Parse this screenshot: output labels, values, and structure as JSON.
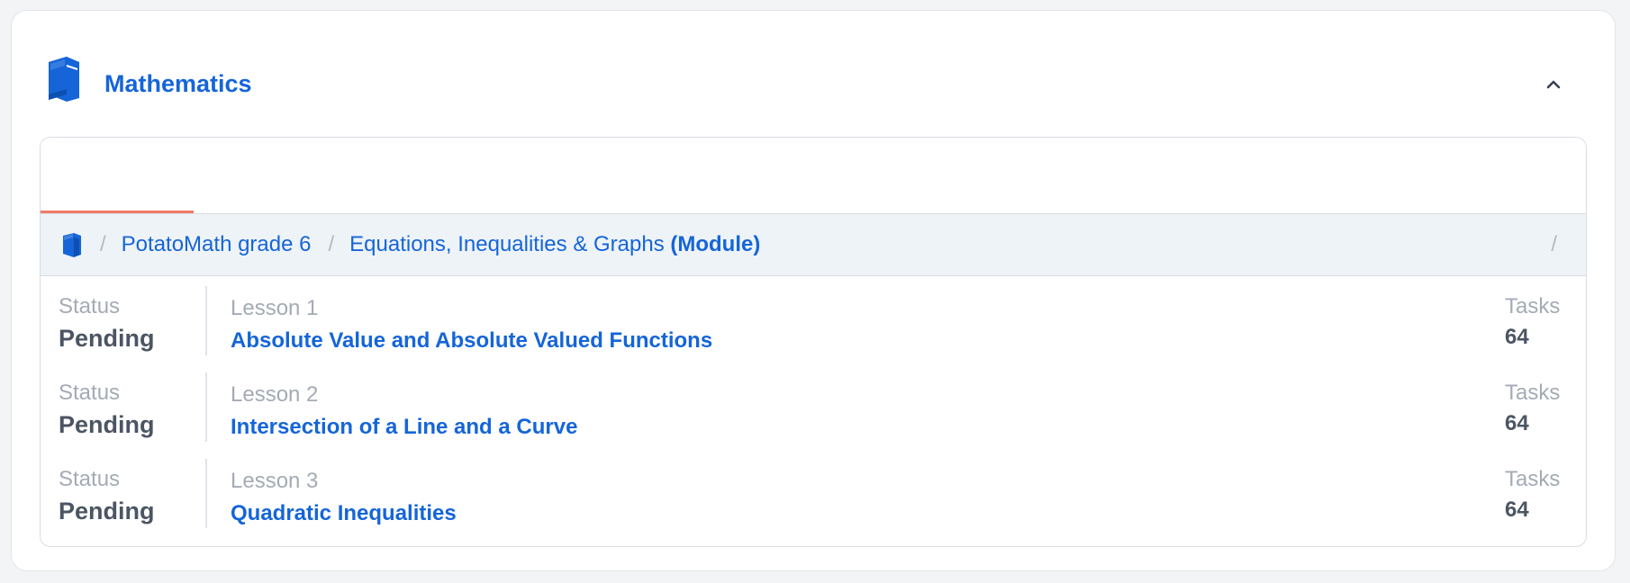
{
  "subject": {
    "icon": "book-icon",
    "title": "Mathematics",
    "collapse_icon": "chevron-up-icon",
    "accent_color": "#1565d8"
  },
  "breadcrumb": {
    "home_icon": "book-icon",
    "separator": "/",
    "course": "PotatoMath grade 6",
    "module_name": "Equations, Inequalities & Graphs",
    "module_type": "(Module)",
    "trailing_separator": "/"
  },
  "tab_indicator_color": "#f07a65",
  "lessons": [
    {
      "status_label": "Status",
      "status": "Pending",
      "lesson_label": "Lesson 1",
      "title": "Absolute Value and Absolute Valued Functions",
      "tasks_label": "Tasks",
      "tasks": "64"
    },
    {
      "status_label": "Status",
      "status": "Pending",
      "lesson_label": "Lesson 2",
      "title": "Intersection of a Line and a Curve",
      "tasks_label": "Tasks",
      "tasks": "64"
    },
    {
      "status_label": "Status",
      "status": "Pending",
      "lesson_label": "Lesson 3",
      "title": "Quadratic Inequalities",
      "tasks_label": "Tasks",
      "tasks": "64"
    }
  ]
}
